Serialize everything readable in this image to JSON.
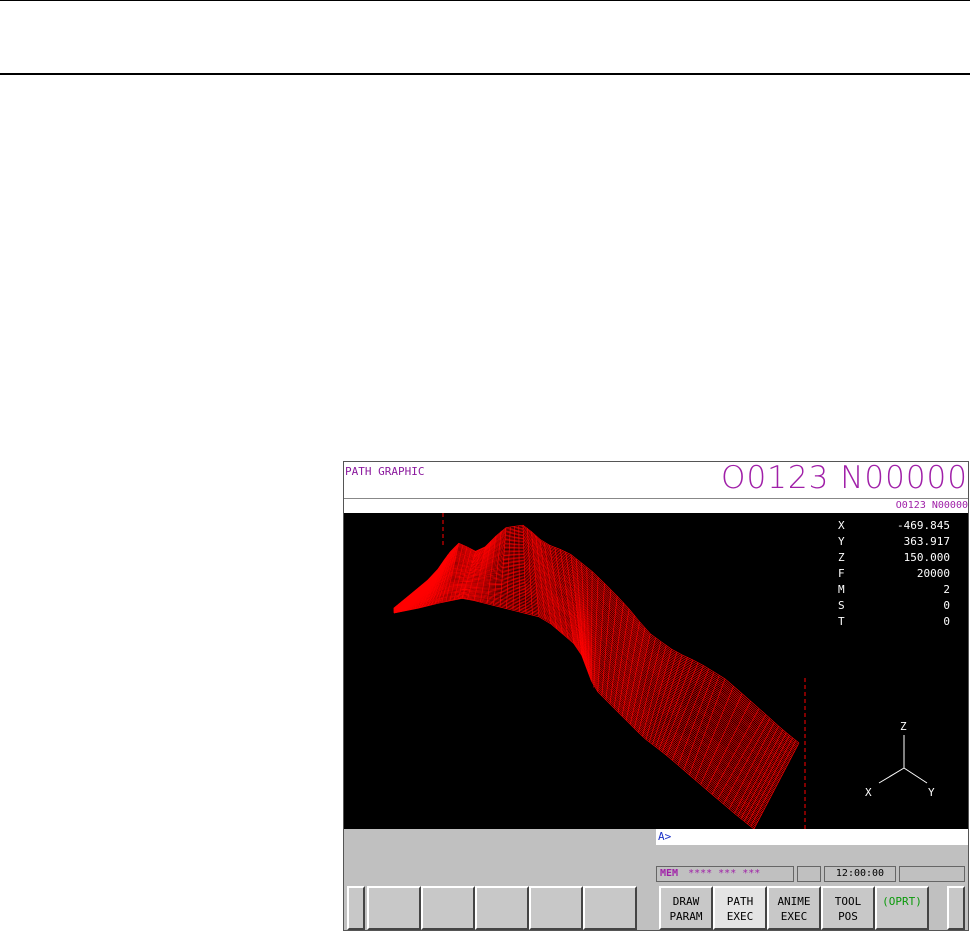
{
  "screen": {
    "title": "PATH GRAPHIC",
    "program_big": "O0123 N00000",
    "program_small": "O0123 N00000"
  },
  "readout": [
    {
      "axis": "X",
      "value": "-469.845"
    },
    {
      "axis": "Y",
      "value": "363.917"
    },
    {
      "axis": "Z",
      "value": "150.000"
    },
    {
      "axis": "F",
      "value": "20000"
    },
    {
      "axis": "M",
      "value": "2"
    },
    {
      "axis": "S",
      "value": "0"
    },
    {
      "axis": "T",
      "value": "0"
    }
  ],
  "axes_triad": {
    "z": "Z",
    "x": "X",
    "y": "Y"
  },
  "command_line": "A>",
  "status": {
    "mode": "MEM",
    "stars": "**** *** ***",
    "time": "12:00:00"
  },
  "softkeys": [
    {
      "label": "",
      "selected": false
    },
    {
      "label": "",
      "selected": false
    },
    {
      "label": "",
      "selected": false
    },
    {
      "label": "",
      "selected": false
    },
    {
      "label": "",
      "selected": false
    },
    {
      "label_1": "DRAW",
      "label_2": "PARAM",
      "selected": false
    },
    {
      "label_1": "PATH",
      "label_2": "EXEC",
      "selected": true
    },
    {
      "label_1": "ANIME",
      "label_2": "EXEC",
      "selected": false
    },
    {
      "label_1": "TOOL",
      "label_2": "POS",
      "selected": false
    },
    {
      "label_1": "(OPRT)",
      "label_2": "",
      "selected": false
    }
  ],
  "colors": {
    "toolpath": "#ff0000",
    "program_text": "#a020a8",
    "oprt_text": "#0a9a0a",
    "command_text": "#1a30c8"
  }
}
